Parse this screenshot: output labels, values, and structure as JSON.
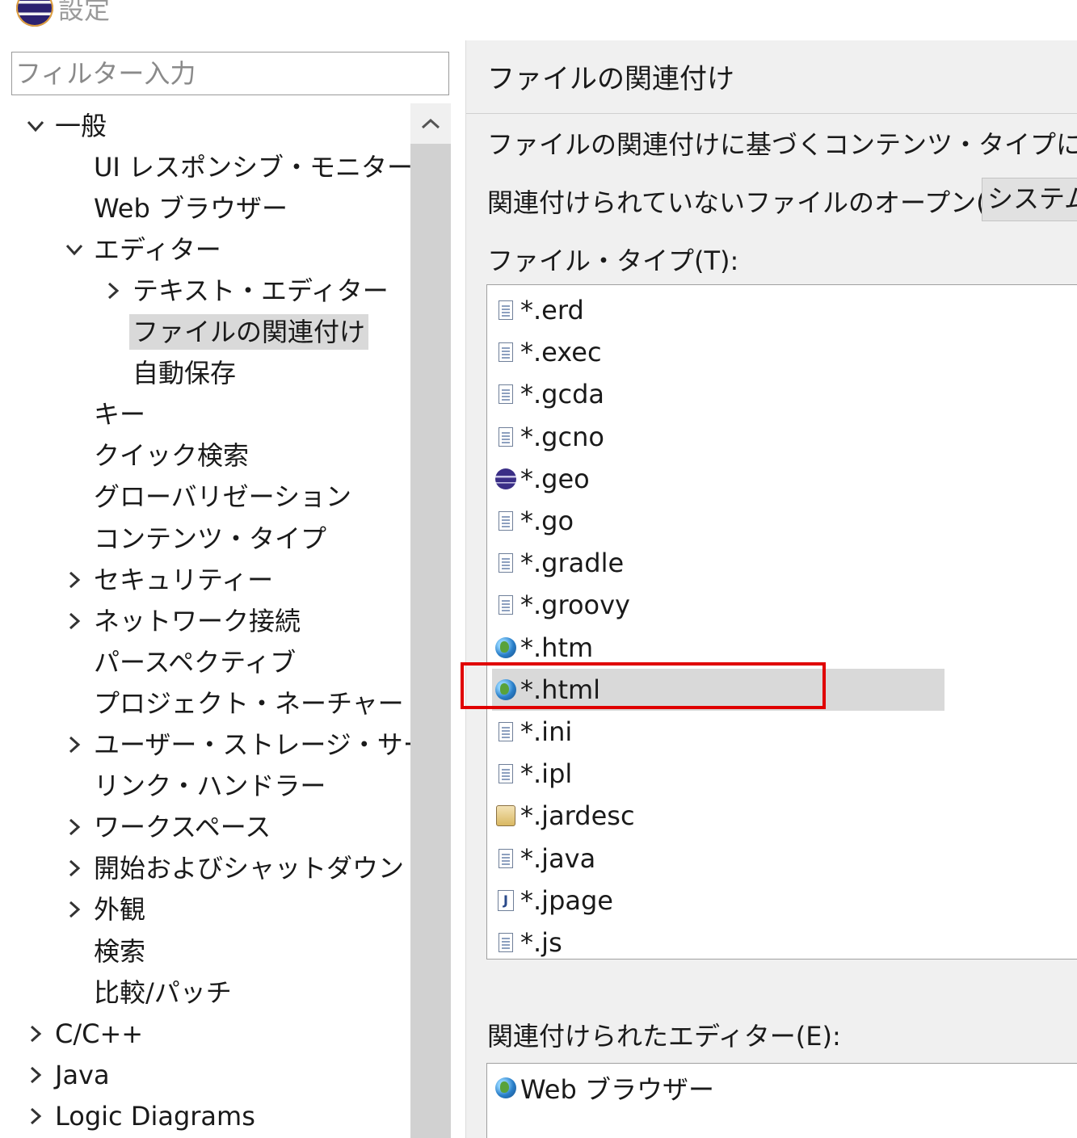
{
  "window": {
    "title": "設定",
    "icon": "eclipse-icon"
  },
  "filter": {
    "placeholder": "フィルター入力",
    "value": ""
  },
  "tree": {
    "items": [
      {
        "label": "一般",
        "level": 0,
        "expander": "expanded"
      },
      {
        "label": "UI レスポンシブ・モニター",
        "level": 1,
        "expander": "none"
      },
      {
        "label": "Web ブラウザー",
        "level": 1,
        "expander": "none"
      },
      {
        "label": "エディター",
        "level": 1,
        "expander": "expanded"
      },
      {
        "label": "テキスト・エディター",
        "level": 2,
        "expander": "collapsed"
      },
      {
        "label": "ファイルの関連付け",
        "level": 2,
        "expander": "none",
        "selected": true
      },
      {
        "label": "自動保存",
        "level": 2,
        "expander": "none"
      },
      {
        "label": "キー",
        "level": 1,
        "expander": "none"
      },
      {
        "label": "クイック検索",
        "level": 1,
        "expander": "none"
      },
      {
        "label": "グローバリゼーション",
        "level": 1,
        "expander": "none"
      },
      {
        "label": "コンテンツ・タイプ",
        "level": 1,
        "expander": "none"
      },
      {
        "label": "セキュリティー",
        "level": 1,
        "expander": "collapsed"
      },
      {
        "label": "ネットワーク接続",
        "level": 1,
        "expander": "collapsed"
      },
      {
        "label": "パースペクティブ",
        "level": 1,
        "expander": "none"
      },
      {
        "label": "プロジェクト・ネーチャー",
        "level": 1,
        "expander": "none"
      },
      {
        "label": "ユーザー・ストレージ・サービス",
        "level": 1,
        "expander": "collapsed"
      },
      {
        "label": "リンク・ハンドラー",
        "level": 1,
        "expander": "none"
      },
      {
        "label": "ワークスペース",
        "level": 1,
        "expander": "collapsed"
      },
      {
        "label": "開始およびシャットダウン",
        "level": 1,
        "expander": "collapsed"
      },
      {
        "label": "外観",
        "level": 1,
        "expander": "collapsed"
      },
      {
        "label": "検索",
        "level": 1,
        "expander": "none"
      },
      {
        "label": "比較/パッチ",
        "level": 1,
        "expander": "none"
      },
      {
        "label": "C/C++",
        "level": 0,
        "expander": "collapsed"
      },
      {
        "label": "Java",
        "level": 0,
        "expander": "collapsed"
      },
      {
        "label": "Logic Diagrams",
        "level": 0,
        "expander": "collapsed"
      }
    ]
  },
  "page": {
    "title": "ファイルの関連付け",
    "description": "ファイルの関連付けに基づくコンテンツ・タイプについて(",
    "open_unassociated_label": "関連付けられていないファイルのオープン(O):",
    "open_unassociated_value": "システム",
    "file_types_label": "ファイル・タイプ(T):",
    "file_types": [
      {
        "name": "*.erd",
        "icon": "text-file-icon"
      },
      {
        "name": "*.exec",
        "icon": "text-file-icon"
      },
      {
        "name": "*.gcda",
        "icon": "text-file-icon"
      },
      {
        "name": "*.gcno",
        "icon": "text-file-icon"
      },
      {
        "name": "*.geo",
        "icon": "eclipse-sphere-icon"
      },
      {
        "name": "*.go",
        "icon": "text-file-icon"
      },
      {
        "name": "*.gradle",
        "icon": "text-file-icon"
      },
      {
        "name": "*.groovy",
        "icon": "text-file-icon"
      },
      {
        "name": "*.htm",
        "icon": "globe-icon"
      },
      {
        "name": "*.html",
        "icon": "globe-icon",
        "selected": true
      },
      {
        "name": "*.ini",
        "icon": "text-file-icon"
      },
      {
        "name": "*.ipl",
        "icon": "text-file-icon"
      },
      {
        "name": "*.jardesc",
        "icon": "jar-icon"
      },
      {
        "name": "*.java",
        "icon": "text-file-icon"
      },
      {
        "name": "*.jpage",
        "icon": "java-page-icon"
      },
      {
        "name": "*.js",
        "icon": "text-file-icon"
      }
    ],
    "associated_editors_label": "関連付けられたエディター(E):",
    "associated_editors": [
      {
        "name": "Web ブラウザー",
        "icon": "globe-icon"
      }
    ]
  },
  "colors": {
    "selection": "#d9d9d9",
    "highlight_border": "#e00000",
    "panel_bg": "#f0f0f0"
  }
}
